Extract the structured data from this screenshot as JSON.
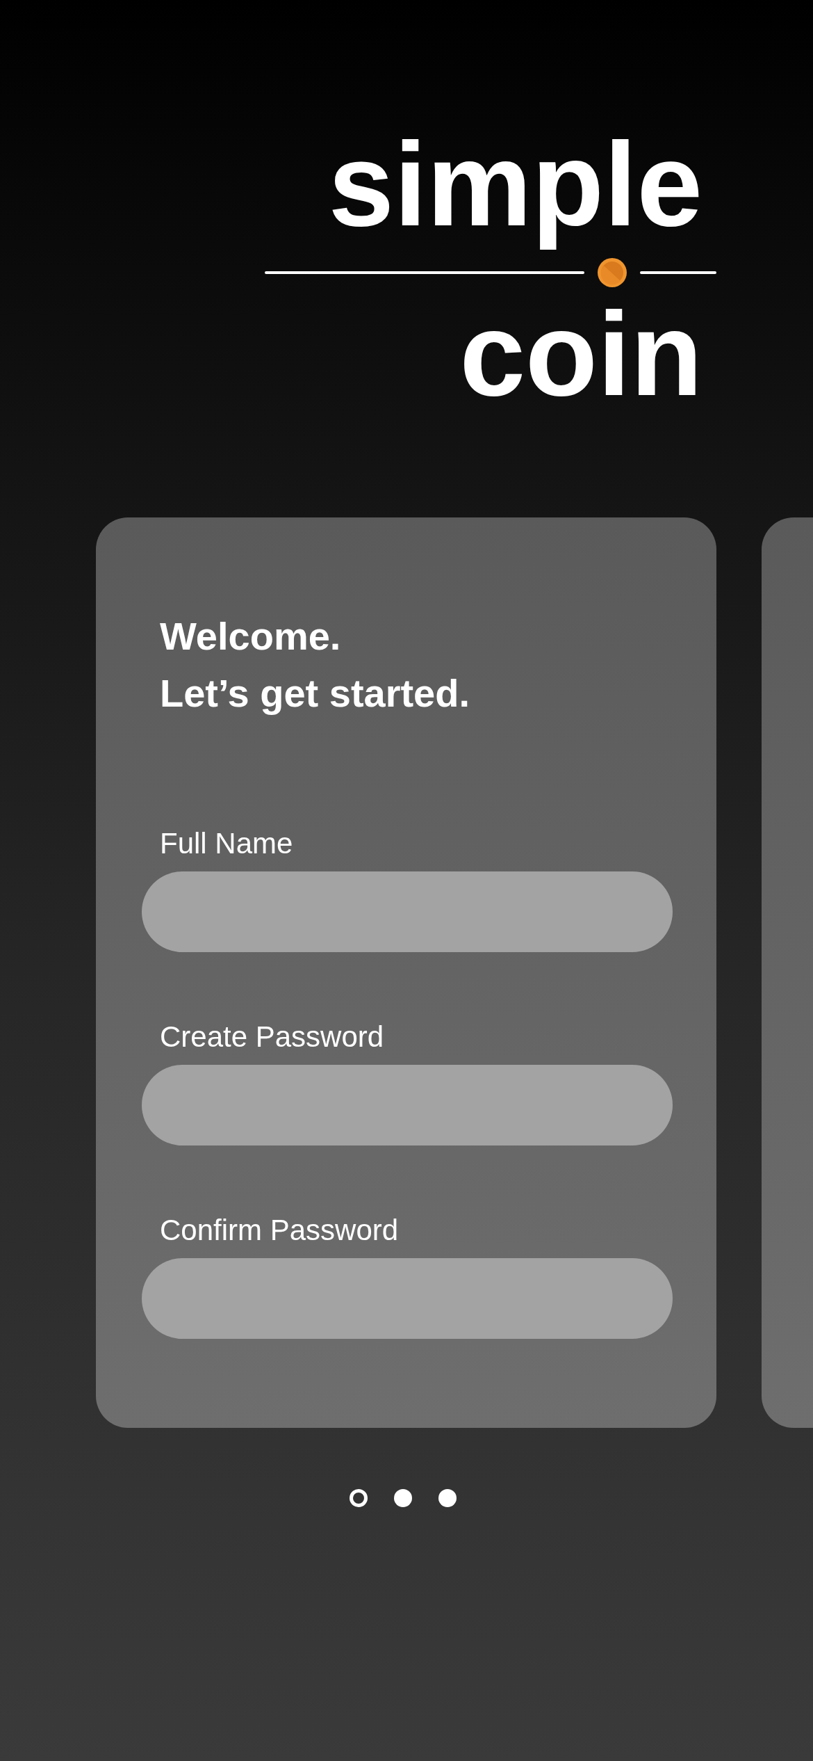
{
  "logo": {
    "word_top": "simple",
    "word_bottom": "coin"
  },
  "card": {
    "title_lines": [
      "Welcome.",
      "Let’s get started."
    ],
    "fields": [
      {
        "label": "Full Name"
      },
      {
        "label": "Create Password"
      },
      {
        "label": "Confirm Password"
      }
    ]
  },
  "pager": [
    {
      "selected": true
    },
    {
      "selected": false
    },
    {
      "selected": false
    }
  ]
}
